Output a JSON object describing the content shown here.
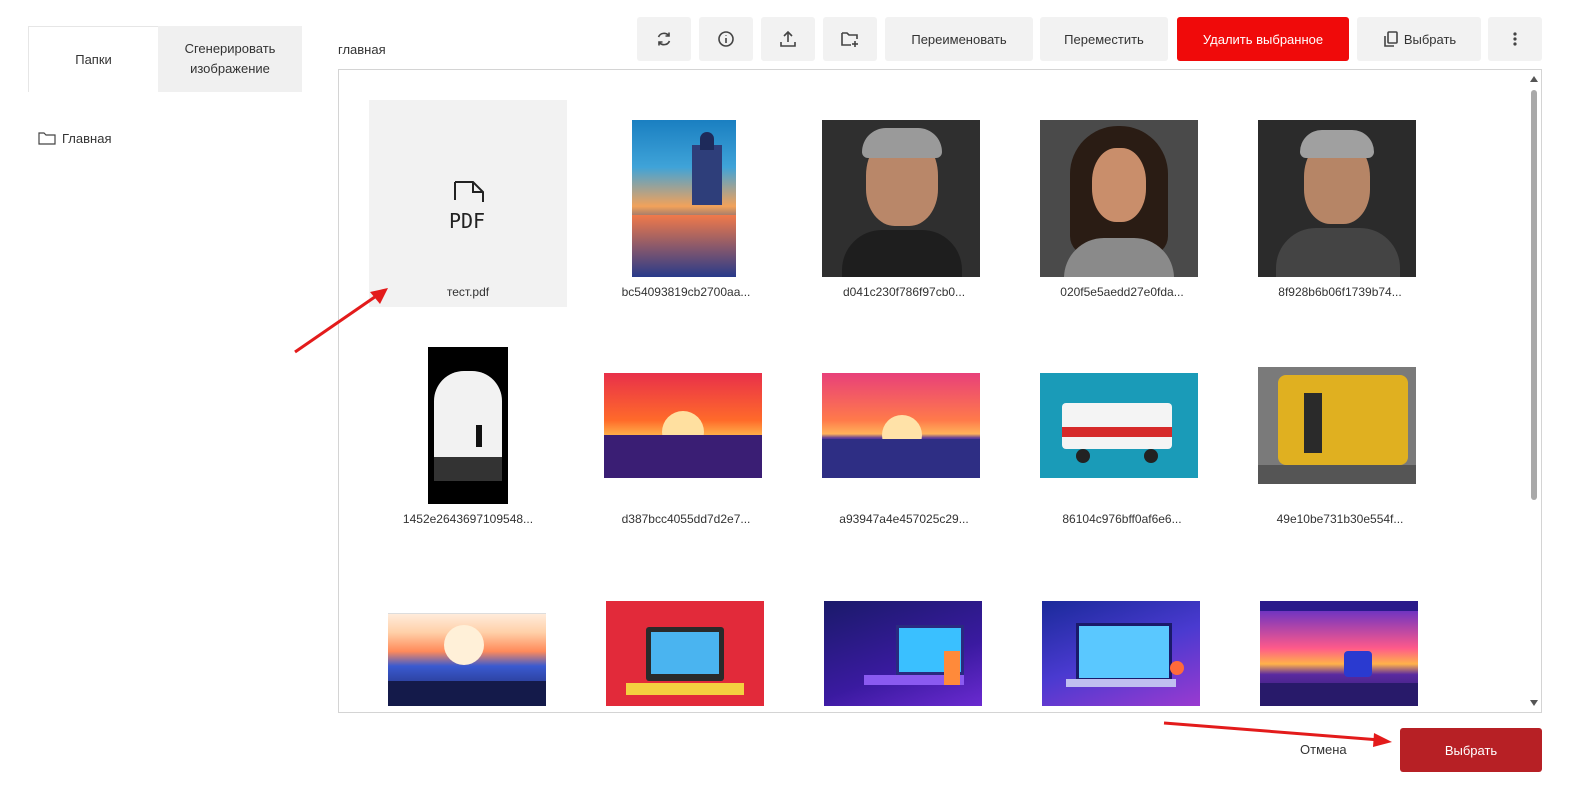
{
  "left_tabs": {
    "folders": "Папки",
    "generate": "Сгенерировать изображение"
  },
  "folder_tree": [
    {
      "label": "Главная",
      "icon": "folder-icon"
    }
  ],
  "breadcrumb": "главная",
  "toolbar": {
    "refresh_icon": "refresh-icon",
    "info_icon": "info-icon",
    "upload_icon": "upload-icon",
    "new_folder_icon": "new-folder-icon",
    "rename": "Переименовать",
    "move": "Переместить",
    "delete": "Удалить выбранное",
    "select": "Выбрать",
    "more_icon": "more-vertical-icon",
    "delete_color": "#f00a0a"
  },
  "files": [
    {
      "name": "тест.pdf",
      "kind": "pdf"
    },
    {
      "name": "bc54093819cb2700aa...",
      "kind": "image"
    },
    {
      "name": "d041c230f786f97cb0...",
      "kind": "image"
    },
    {
      "name": "020f5e5aedd27e0fda...",
      "kind": "image"
    },
    {
      "name": "8f928b6b06f1739b74...",
      "kind": "image"
    },
    {
      "name": "1452e2643697109548...",
      "kind": "image"
    },
    {
      "name": "d387bcc4055dd7d2e7...",
      "kind": "image"
    },
    {
      "name": "a93947a4e457025c29...",
      "kind": "image"
    },
    {
      "name": "86104c976bff0af6e6...",
      "kind": "image"
    },
    {
      "name": "49e10be731b30e554f...",
      "kind": "image"
    },
    {
      "name": "",
      "kind": "image"
    },
    {
      "name": "",
      "kind": "image"
    },
    {
      "name": "",
      "kind": "image"
    },
    {
      "name": "",
      "kind": "image"
    },
    {
      "name": "",
      "kind": "image"
    }
  ],
  "pdf_label": "PDF",
  "footer": {
    "cancel": "Отмена",
    "select": "Выбрать",
    "select_color": "#b72025"
  }
}
